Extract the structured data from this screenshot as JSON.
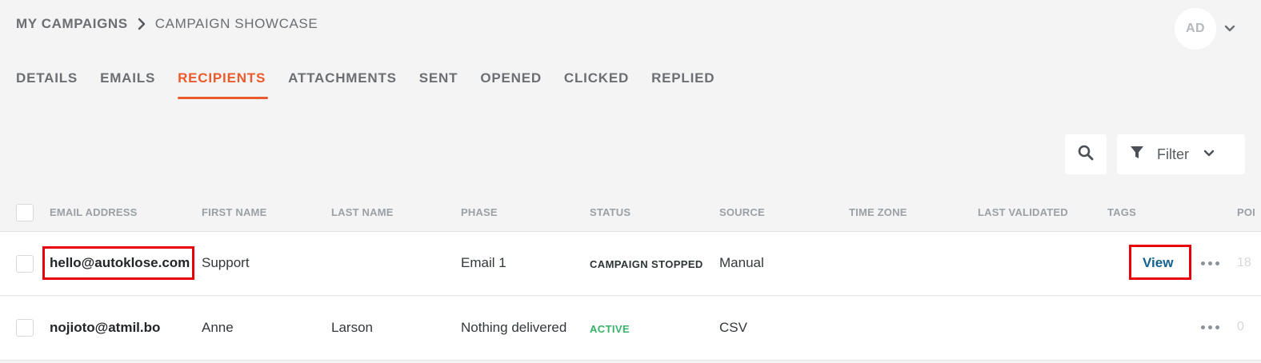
{
  "breadcrumb": {
    "root": "MY CAMPAIGNS",
    "current": "CAMPAIGN SHOWCASE"
  },
  "user": {
    "initials": "AD"
  },
  "tabs": [
    {
      "label": "DETAILS",
      "active": false
    },
    {
      "label": "EMAILS",
      "active": false
    },
    {
      "label": "RECIPIENTS",
      "active": true
    },
    {
      "label": "ATTACHMENTS",
      "active": false
    },
    {
      "label": "SENT",
      "active": false
    },
    {
      "label": "OPENED",
      "active": false
    },
    {
      "label": "CLICKED",
      "active": false
    },
    {
      "label": "REPLIED",
      "active": false
    }
  ],
  "toolbar": {
    "search_icon": "search-icon",
    "filter_label": "Filter",
    "filter_icon": "funnel-icon"
  },
  "table": {
    "headers": {
      "email": "EMAIL ADDRESS",
      "first_name": "FIRST NAME",
      "last_name": "LAST NAME",
      "phase": "PHASE",
      "status": "STATUS",
      "source": "SOURCE",
      "time_zone": "TIME ZONE",
      "last_validated": "LAST VALIDATED",
      "tags": "TAGS",
      "points": "POI"
    },
    "rows": [
      {
        "email": "hello@autoklose.com",
        "first_name": "Support",
        "last_name": "",
        "phase": "Email 1",
        "status": "CAMPAIGN STOPPED",
        "source": "Manual",
        "tags_link": "View",
        "points": "18"
      },
      {
        "email": "nojioto@atmil.bo",
        "first_name": "Anne",
        "last_name": "Larson",
        "phase": "Nothing delivered",
        "status": "ACTIVE",
        "source": "CSV",
        "points": "0"
      }
    ]
  },
  "colors": {
    "accent": "#eb5a2c",
    "status_active": "#38b36a",
    "link": "#12618f",
    "highlight": "#e8000b"
  }
}
